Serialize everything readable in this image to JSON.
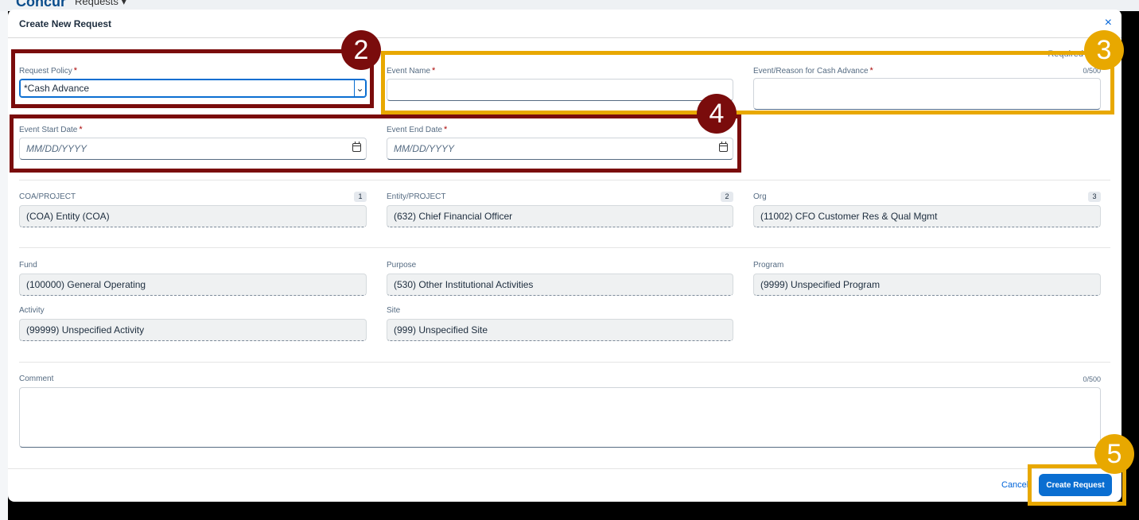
{
  "background_app": {
    "logo": "Concur",
    "nav_item": "Requests ▾"
  },
  "dialog": {
    "title": "Create New Request",
    "close_icon": "×",
    "required_note": "Required",
    "request_policy": {
      "label": "Request Policy",
      "required_mark": "*",
      "value": "*Cash Advance"
    },
    "event_name": {
      "label": "Event Name",
      "required_mark": "*",
      "value": ""
    },
    "event_reason": {
      "label": "Event/Reason for Cash Advance",
      "required_mark": "*",
      "counter": "0/500",
      "value": ""
    },
    "event_start_date": {
      "label": "Event Start Date",
      "required_mark": "*",
      "placeholder": "MM/DD/YYYY"
    },
    "event_end_date": {
      "label": "Event End Date",
      "required_mark": "*",
      "placeholder": "MM/DD/YYYY"
    },
    "coa_project": {
      "label": "COA/PROJECT",
      "badge": "1",
      "value": "(COA) Entity (COA)"
    },
    "entity_project": {
      "label": "Entity/PROJECT",
      "badge": "2",
      "value": "(632) Chief Financial Officer"
    },
    "org": {
      "label": "Org",
      "badge": "3",
      "value": "(11002) CFO Customer Res & Qual Mgmt"
    },
    "fund": {
      "label": "Fund",
      "value": "(100000) General Operating"
    },
    "purpose": {
      "label": "Purpose",
      "value": "(530) Other Institutional Activities"
    },
    "program": {
      "label": "Program",
      "value": "(9999) Unspecified Program"
    },
    "activity": {
      "label": "Activity",
      "value": "(99999) Unspecified Activity"
    },
    "site": {
      "label": "Site",
      "value": "(999) Unspecified Site"
    },
    "comment": {
      "label": "Comment",
      "counter": "0/500",
      "value": ""
    },
    "footer": {
      "cancel_label": "Cancel",
      "create_label": "Create Request"
    }
  },
  "annotations": [
    {
      "number": "2",
      "color": "#7a0c0c"
    },
    {
      "number": "3",
      "color": "#e8a800"
    },
    {
      "number": "4",
      "color": "#7a0c0c"
    },
    {
      "number": "5",
      "color": "#e8a800"
    }
  ],
  "colors": {
    "accent": "#0a6ed1",
    "required": "#aa0808",
    "annotation_dark_red": "#7a0c0c",
    "annotation_gold": "#e8a800"
  }
}
